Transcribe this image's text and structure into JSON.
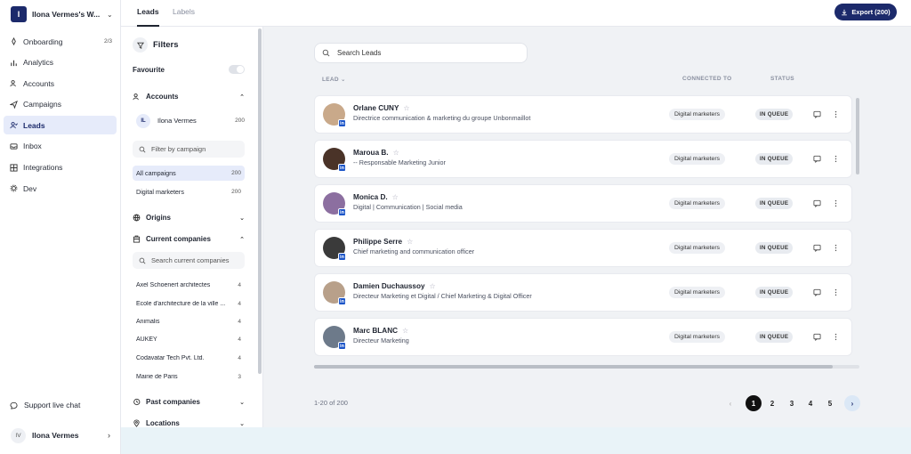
{
  "workspace": {
    "initial": "I",
    "name": "Ilona Vermes's W..."
  },
  "nav": [
    {
      "label": "Onboarding",
      "icon": "rocket-icon",
      "badge": "2/3"
    },
    {
      "label": "Analytics",
      "icon": "chart-icon",
      "badge": ""
    },
    {
      "label": "Accounts",
      "icon": "users-icon",
      "badge": ""
    },
    {
      "label": "Campaigns",
      "icon": "send-icon",
      "badge": ""
    },
    {
      "label": "Leads",
      "icon": "user-check-icon",
      "badge": ""
    },
    {
      "label": "Inbox",
      "icon": "inbox-icon",
      "badge": ""
    },
    {
      "label": "Integrations",
      "icon": "grid-icon",
      "badge": ""
    },
    {
      "label": "Dev",
      "icon": "gear-icon",
      "badge": ""
    }
  ],
  "support_label": "Support live chat",
  "user": {
    "initials": "IV",
    "name": "Ilona Vermes"
  },
  "tabs": {
    "leads": "Leads",
    "labels": "Labels"
  },
  "export_label": "Export (200)",
  "filters": {
    "title": "Filters",
    "favourite": "Favourite",
    "accounts_label": "Accounts",
    "account": {
      "initials": "IL",
      "name": "Ilona Vermes",
      "count": "200"
    },
    "campaign_placeholder": "Filter by campaign",
    "campaigns": [
      {
        "name": "All campaigns",
        "count": "200"
      },
      {
        "name": "Digital marketers",
        "count": "200"
      }
    ],
    "origins_label": "Origins",
    "current_companies_label": "Current companies",
    "companies_placeholder": "Search current companies",
    "companies": [
      {
        "name": "Axel Schoenert architectes",
        "count": "4"
      },
      {
        "name": "École d'architecture de la ville ...",
        "count": "4"
      },
      {
        "name": "Animalis",
        "count": "4"
      },
      {
        "name": "AUKEY",
        "count": "4"
      },
      {
        "name": "Codavatar Tech Pvt. Ltd.",
        "count": "4"
      },
      {
        "name": "Mairie de Paris",
        "count": "3"
      }
    ],
    "past_companies_label": "Past companies",
    "locations_label": "Locations"
  },
  "search_placeholder": "Search Leads",
  "columns": {
    "lead": "LEAD",
    "connected": "CONNECTED TO",
    "status": "STATUS"
  },
  "leads": [
    {
      "name": "Orlane CUNY",
      "title": "Directrice communication & marketing du groupe Unbonmaillot",
      "campaign": "Digital marketers",
      "status": "IN QUEUE",
      "avatar": "#c9a98a"
    },
    {
      "name": "Maroua B.",
      "title": "-- Responsable Marketing Junior",
      "campaign": "Digital marketers",
      "status": "IN QUEUE",
      "avatar": "#4a3328"
    },
    {
      "name": "Monica D.",
      "title": "Digital | Communication | Social media",
      "campaign": "Digital marketers",
      "status": "IN QUEUE",
      "avatar": "#8c6fa0"
    },
    {
      "name": "Philippe Serre",
      "title": "Chief marketing and communication officer",
      "campaign": "Digital marketers",
      "status": "IN QUEUE",
      "avatar": "#3a3a3a"
    },
    {
      "name": "Damien Duchaussoy",
      "title": "Directeur Marketing et Digital / Chief Marketing & Digital Officer",
      "campaign": "Digital marketers",
      "status": "IN QUEUE",
      "avatar": "#b8a08a"
    },
    {
      "name": "Marc BLANC",
      "title": "Directeur Marketing",
      "campaign": "Digital marketers",
      "status": "IN QUEUE",
      "avatar": "#6d7a8a"
    }
  ],
  "pagination": {
    "range": "1-20 of 200",
    "prev": "‹",
    "pages": [
      "1",
      "2",
      "3",
      "4",
      "5"
    ],
    "next": "›"
  },
  "colors": {
    "brand": "#1c2a6b",
    "linkedin": "#1c55c8",
    "main_bg": "#f0f2f5"
  }
}
